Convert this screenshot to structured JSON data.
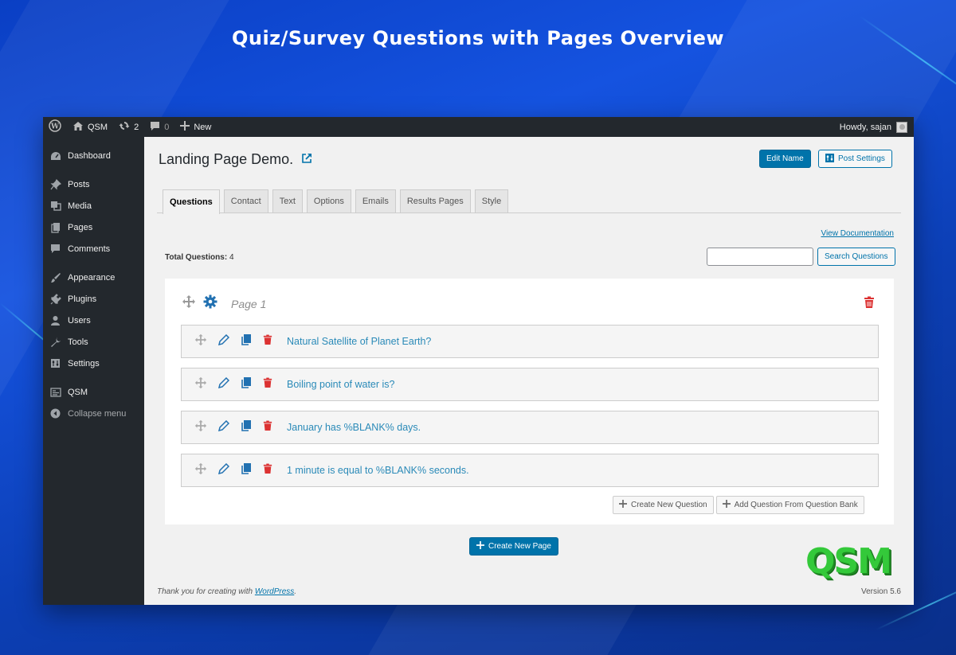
{
  "hero": {
    "title": "Quiz/Survey Questions with Pages Overview"
  },
  "adminbar": {
    "site_name": "QSM",
    "updates_count": "2",
    "comments_count": "0",
    "new_label": "New",
    "howdy": "Howdy, sajan"
  },
  "sidebar": {
    "items": [
      {
        "label": "Dashboard",
        "icon": "dashboard-icon"
      },
      {
        "label": "Posts",
        "icon": "pin-icon"
      },
      {
        "label": "Media",
        "icon": "media-icon"
      },
      {
        "label": "Pages",
        "icon": "pages-icon"
      },
      {
        "label": "Comments",
        "icon": "comment-icon"
      },
      {
        "label": "Appearance",
        "icon": "brush-icon"
      },
      {
        "label": "Plugins",
        "icon": "plug-icon"
      },
      {
        "label": "Users",
        "icon": "user-icon"
      },
      {
        "label": "Tools",
        "icon": "wrench-icon"
      },
      {
        "label": "Settings",
        "icon": "settings-icon"
      },
      {
        "label": "QSM",
        "icon": "qsm-icon"
      }
    ],
    "collapse_label": "Collapse menu"
  },
  "header": {
    "title": "Landing Page Demo.",
    "edit_name_label": "Edit Name",
    "post_settings_label": "Post Settings"
  },
  "tabs": [
    "Questions",
    "Contact",
    "Text",
    "Options",
    "Emails",
    "Results Pages",
    "Style"
  ],
  "toolbar": {
    "view_documentation": "View Documentation",
    "total_questions_label": "Total Questions:",
    "total_questions_value": "4",
    "search_placeholder": "",
    "search_button": "Search Questions"
  },
  "page": {
    "name": "Page 1",
    "questions": [
      "Natural Satellite of Planet Earth?",
      "Boiling point of water is?",
      "January has %BLANK% days.",
      "1 minute is equal to %BLANK% seconds."
    ],
    "create_question_label": "Create New Question",
    "add_from_bank_label": "Add Question From Question Bank"
  },
  "create_page_label": "Create New Page",
  "footer": {
    "thanks_prefix": "Thank you for creating with",
    "thanks_link": "WordPress",
    "thanks_suffix": ".",
    "version": "Version 5.6"
  },
  "logo_text": "QSM",
  "colors": {
    "primary": "#0073aa",
    "danger": "#dc3232",
    "admin_bg": "#23282d",
    "question_text": "#2a8ab8",
    "logo_green": "#34c93a"
  }
}
